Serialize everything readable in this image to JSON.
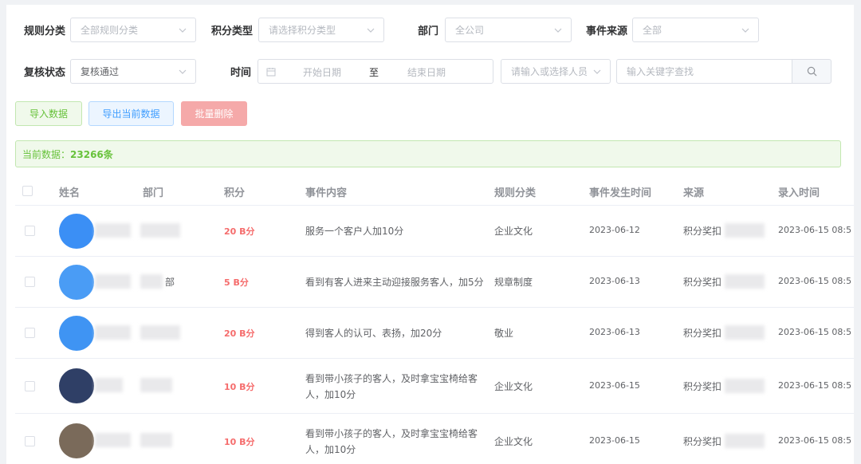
{
  "filters": {
    "rule_category": {
      "label": "规则分类",
      "placeholder": "全部规则分类"
    },
    "score_type": {
      "label": "积分类型",
      "placeholder": "请选择积分类型"
    },
    "department": {
      "label": "部门",
      "placeholder": "全公司"
    },
    "event_source": {
      "label": "事件来源",
      "placeholder": "全部"
    },
    "review_status": {
      "label": "复核状态",
      "value": "复核通过"
    },
    "time": {
      "label": "时间",
      "start_placeholder": "开始日期",
      "separator": "至",
      "end_placeholder": "结束日期"
    },
    "person": {
      "placeholder": "请输入或选择人员"
    },
    "keyword": {
      "placeholder": "输入关键字查找"
    }
  },
  "actions": {
    "import": "导入数据",
    "export": "导出当前数据",
    "batch_delete": "批量删除"
  },
  "summary": {
    "prefix": "当前数据：",
    "count": "23266条"
  },
  "table": {
    "headers": [
      "姓名",
      "部门",
      "积分",
      "事件内容",
      "规则分类",
      "事件发生时间",
      "来源",
      "录入时间"
    ],
    "rows": [
      {
        "dept": "",
        "score": "20 B分",
        "content": "服务一个客户人加10分",
        "rule": "企业文化",
        "event_date": "2023-06-12",
        "source": "积分奖扣",
        "entry_time": "2023-06-15 08:5"
      },
      {
        "dept": "部",
        "score": "5 B分",
        "content": "看到有客人进来主动迎接服务客人，加5分",
        "rule": "规章制度",
        "event_date": "2023-06-13",
        "source": "积分奖扣",
        "entry_time": "2023-06-15 08:5"
      },
      {
        "dept": "",
        "score": "20 B分",
        "content": "得到客人的认可、表扬，加20分",
        "rule": "敬业",
        "event_date": "2023-06-13",
        "source": "积分奖扣",
        "entry_time": "2023-06-15 08:5"
      },
      {
        "dept": "",
        "score": "10 B分",
        "content": "看到带小孩子的客人，及时拿宝宝椅给客人，加10分",
        "rule": "企业文化",
        "event_date": "2023-06-15",
        "source": "积分奖扣",
        "entry_time": "2023-06-15 08:5"
      },
      {
        "dept": "",
        "score": "10 B分",
        "content": "看到带小孩子的客人，及时拿宝宝椅给客人，加10分",
        "rule": "企业文化",
        "event_date": "2023-06-15",
        "source": "积分奖扣",
        "entry_time": "2023-06-15 08:5"
      }
    ]
  },
  "colors": {
    "primary": "#409eff",
    "success": "#67c23a",
    "danger": "#f56c6c"
  }
}
